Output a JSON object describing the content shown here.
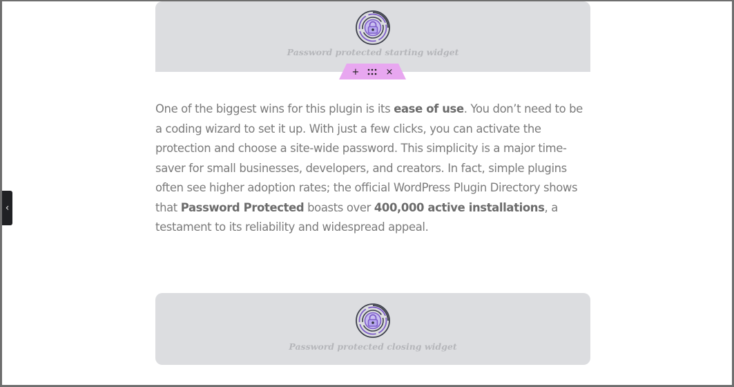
{
  "widgets": {
    "top_caption": "Password protected starting widget",
    "bottom_caption": "Password protected closing widget",
    "icon": "fingerprint-lock-icon"
  },
  "toolbar": {
    "add_icon": "+",
    "drag_icon": "⠿",
    "close_icon": "×",
    "accent": "#e8a7f0"
  },
  "content": {
    "p1": "One of the biggest wins for this plugin is its ",
    "b1": "ease of use",
    "p2": ". You don’t need to be a coding wizard to set it up. With just a few clicks, you can activate the protection and choose a site-wide password. This simplicity is a major time-saver for small businesses, developers, and creators. In fact, simple plugins often see higher adoption rates; the official WordPress Plugin Directory shows that ",
    "b2": "Password Protected",
    "p3": " boasts over ",
    "b3": "400,000 active installations",
    "p4": ", a testament to its reliability and widespread appeal."
  },
  "side_panel": {
    "toggle_icon": "‹"
  }
}
